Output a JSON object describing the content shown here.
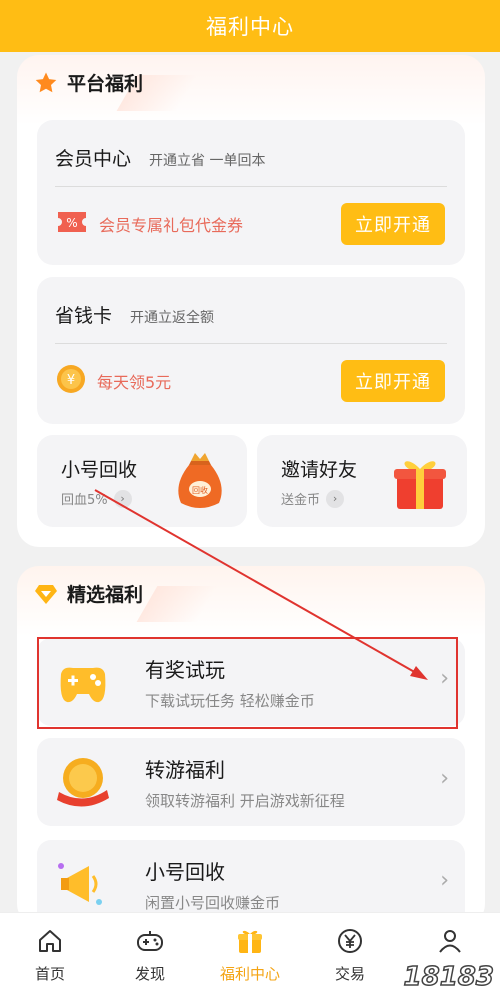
{
  "header": {
    "title": "福利中心"
  },
  "platform": {
    "section_title": "平台福利",
    "member": {
      "title": "会员中心",
      "subtitle": "开通立省 一单回本",
      "promo": "会员专属礼包代金券",
      "button": "立即开通"
    },
    "saver": {
      "title": "省钱卡",
      "subtitle": "开通立返全额",
      "promo": "每天领5元",
      "button": "立即开通"
    },
    "tiles": [
      {
        "title": "小号回收",
        "subtitle": "回血5%"
      },
      {
        "title": "邀请好友",
        "subtitle": "送金币"
      }
    ]
  },
  "selected": {
    "section_title": "精选福利",
    "entries": [
      {
        "title": "有奖试玩",
        "subtitle": "下载试玩任务 轻松赚金币"
      },
      {
        "title": "转游福利",
        "subtitle": "领取转游福利 开启游戏新征程"
      },
      {
        "title": "小号回收",
        "subtitle": "闲置小号回收赚金币"
      }
    ]
  },
  "tabbar": {
    "tabs": [
      {
        "label": "首页",
        "icon": "home-icon"
      },
      {
        "label": "发现",
        "icon": "gamepad-icon"
      },
      {
        "label": "福利中心",
        "icon": "gift-icon",
        "active": true
      },
      {
        "label": "交易",
        "icon": "yen-icon"
      },
      {
        "label": "",
        "icon": "profile-icon"
      }
    ]
  },
  "watermark": {
    "text": "18183"
  },
  "colors": {
    "brand": "#ffbd14",
    "promo_text": "#e86a5a",
    "annotation": "#e0342f",
    "active_tab": "#f4a414"
  }
}
